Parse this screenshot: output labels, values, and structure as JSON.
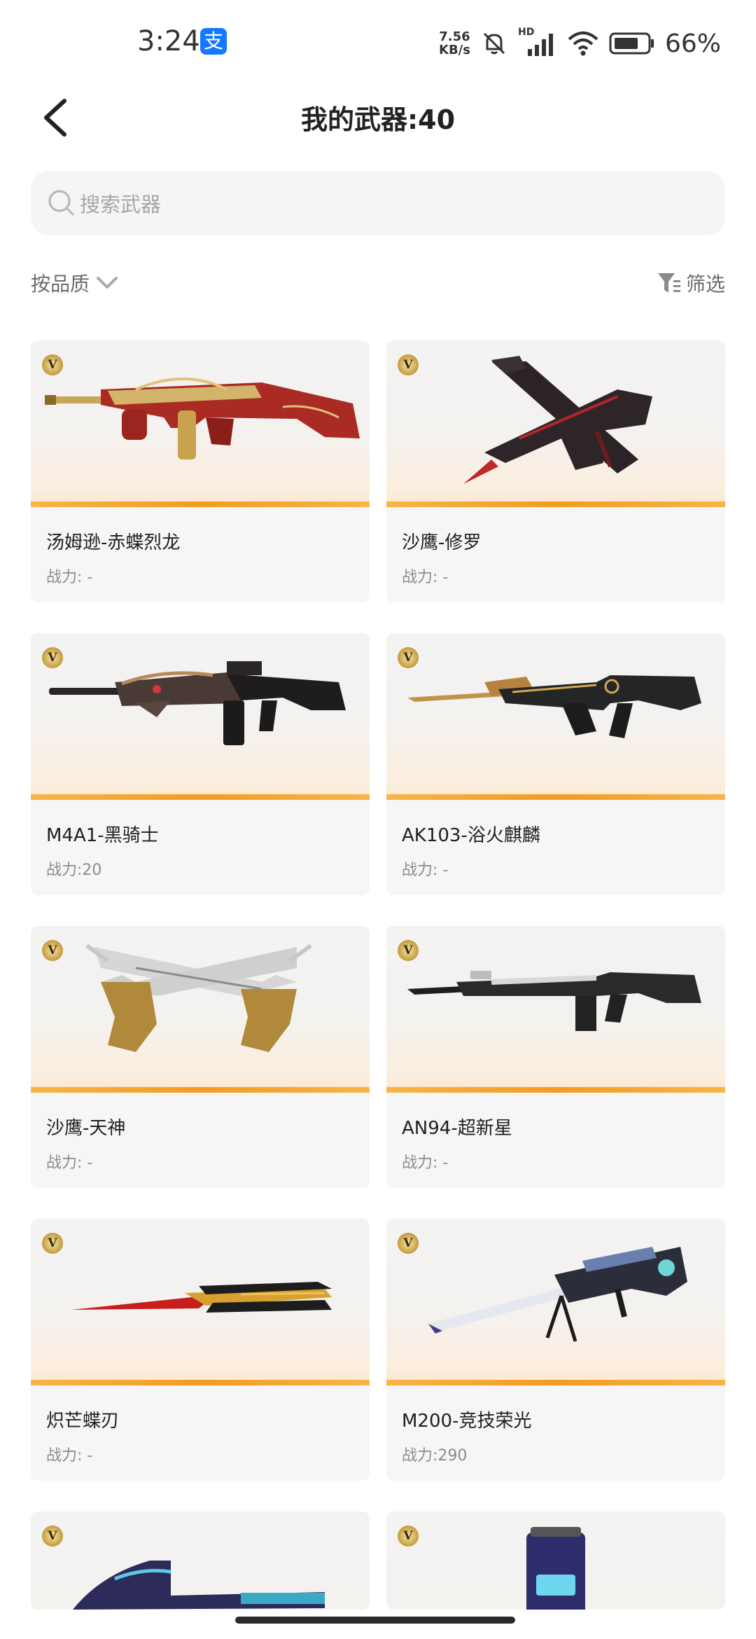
{
  "status_bar": {
    "time": "3:24",
    "app_icon": "支",
    "speed_value": "7.56",
    "speed_unit": "KB/s",
    "network_label": "HD",
    "battery_percent": "66%"
  },
  "header": {
    "title": "我的武器:40"
  },
  "search": {
    "placeholder": "搜索武器"
  },
  "toolbar": {
    "sort_label": "按品质",
    "filter_label": "筛选"
  },
  "colors": {
    "accent_orange": "#f39b22",
    "card_background": "#f6f6f6"
  },
  "weapons": [
    {
      "name": "汤姆逊-赤蝶烈龙",
      "power": "战力: -",
      "badge": "V"
    },
    {
      "name": "沙鹰-修罗",
      "power": "战力: -",
      "badge": "V"
    },
    {
      "name": "M4A1-黑骑士",
      "power": "战力:20",
      "badge": "V"
    },
    {
      "name": "AK103-浴火麒麟",
      "power": "战力: -",
      "badge": "V"
    },
    {
      "name": "沙鹰-天神",
      "power": "战力: -",
      "badge": "V"
    },
    {
      "name": "AN94-超新星",
      "power": "战力: -",
      "badge": "V"
    },
    {
      "name": "炽芒蝶刃",
      "power": "战力: -",
      "badge": "V"
    },
    {
      "name": "M200-竞技荣光",
      "power": "战力:290",
      "badge": "V"
    },
    {
      "badge": "V"
    },
    {
      "badge": "V"
    }
  ]
}
